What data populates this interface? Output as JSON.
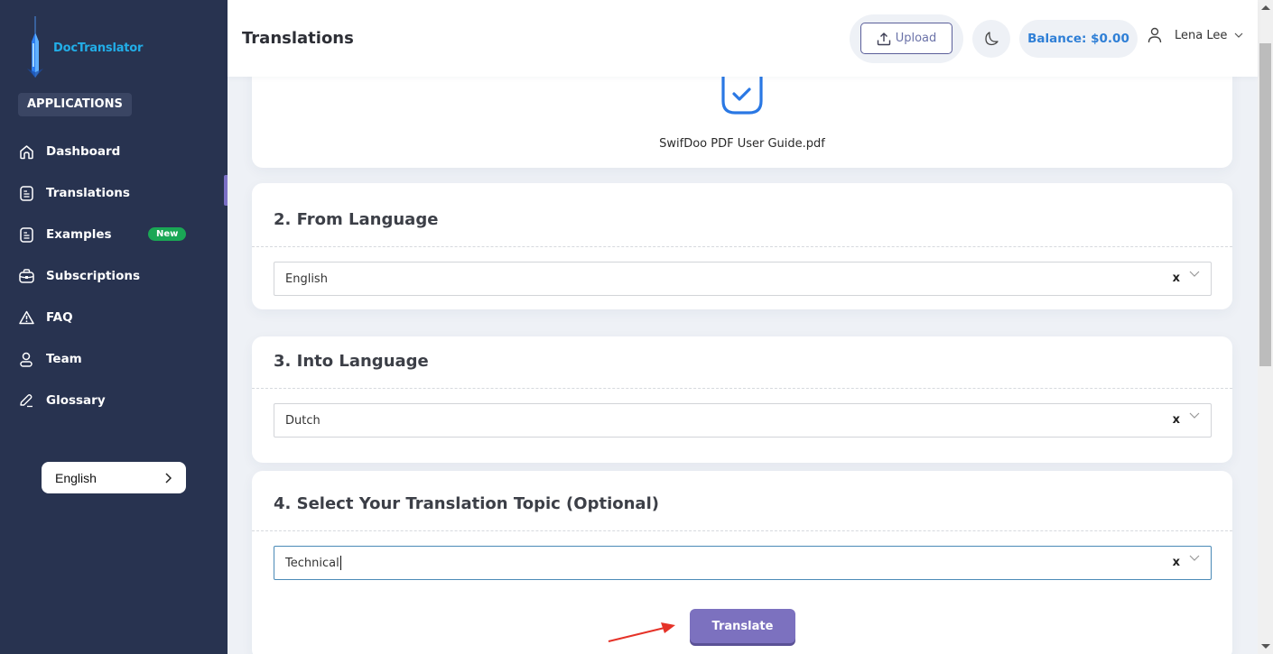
{
  "app": {
    "name": "DocTranslator"
  },
  "sidebar": {
    "section_label": "APPLICATIONS",
    "items": [
      {
        "label": "Dashboard",
        "icon": "home-icon",
        "active": false
      },
      {
        "label": "Translations",
        "icon": "document-icon",
        "active": true
      },
      {
        "label": "Examples",
        "icon": "document-icon",
        "badge": "New",
        "active": false
      },
      {
        "label": "Subscriptions",
        "icon": "briefcase-icon",
        "active": false
      },
      {
        "label": "FAQ",
        "icon": "warning-icon",
        "active": false
      },
      {
        "label": "Team",
        "icon": "user-icon",
        "active": false
      },
      {
        "label": "Glossary",
        "icon": "pencil-icon",
        "active": false
      }
    ],
    "language": {
      "label": "English",
      "icon": "chevron-right-icon"
    }
  },
  "header": {
    "title": "Translations",
    "upload_label": "Upload",
    "balance": "Balance: $0.00",
    "user_name": "Lena Lee"
  },
  "file_card": {
    "file_name": "SwifDoo PDF User Guide.pdf",
    "icon": "check-square-icon"
  },
  "from_language": {
    "title": "2. From Language",
    "value": "English",
    "clear": "x"
  },
  "into_language": {
    "title": "3. Into Language",
    "value": "Dutch",
    "clear": "x"
  },
  "topic": {
    "title": "4. Select Your Translation Topic (Optional)",
    "value": "Technical",
    "clear": "x"
  },
  "translate_button": "Translate",
  "colors": {
    "sidebar_bg": "#283350",
    "accent": "#7c71bf",
    "brand": "#22aee8",
    "balance_text": "#2f7fd6",
    "badge_new": "#1aa755",
    "annotation_arrow": "#e53228"
  }
}
